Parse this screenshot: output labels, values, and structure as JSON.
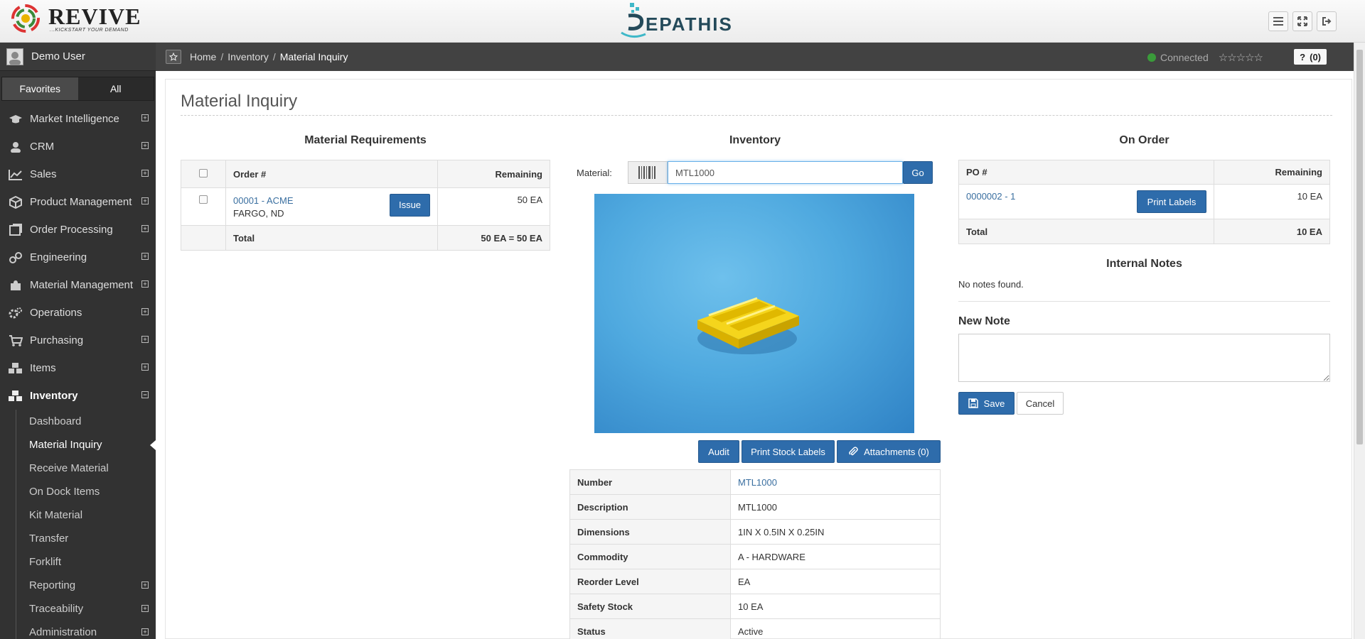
{
  "header": {
    "brand_name": "REVIVE",
    "brand_tagline": "...KICKSTART YOUR DEMAND",
    "product_name": "EPATHIS"
  },
  "user": {
    "name": "Demo User"
  },
  "sidebar": {
    "tabs": [
      {
        "label": "Favorites"
      },
      {
        "label": "All"
      }
    ],
    "items": [
      {
        "label": "Market Intelligence",
        "icon": "graduation-cap-icon"
      },
      {
        "label": "CRM",
        "icon": "user-icon"
      },
      {
        "label": "Sales",
        "icon": "line-chart-icon"
      },
      {
        "label": "Product Management",
        "icon": "cube-icon"
      },
      {
        "label": "Order Processing",
        "icon": "file-icon"
      },
      {
        "label": "Engineering",
        "icon": "link-icon"
      },
      {
        "label": "Material Management",
        "icon": "puzzle-icon"
      },
      {
        "label": "Operations",
        "icon": "gears-icon"
      },
      {
        "label": "Purchasing",
        "icon": "cart-icon"
      },
      {
        "label": "Items",
        "icon": "cubes-icon"
      },
      {
        "label": "Inventory",
        "icon": "cubes-icon"
      }
    ],
    "inventory_sub": [
      {
        "label": "Dashboard"
      },
      {
        "label": "Material Inquiry"
      },
      {
        "label": "Receive Material"
      },
      {
        "label": "On Dock Items"
      },
      {
        "label": "Kit Material"
      },
      {
        "label": "Transfer"
      },
      {
        "label": "Forklift"
      },
      {
        "label": "Reporting"
      },
      {
        "label": "Traceability"
      },
      {
        "label": "Administration"
      }
    ]
  },
  "breadcrumb": {
    "items": [
      {
        "label": "Home"
      },
      {
        "label": "Inventory"
      },
      {
        "label": "Material Inquiry"
      }
    ],
    "status": "Connected",
    "stars": "☆☆☆☆☆",
    "help_label": "(0)"
  },
  "page": {
    "title": "Material Inquiry"
  },
  "requirements": {
    "title": "Material Requirements",
    "columns": {
      "order": "Order #",
      "remaining": "Remaining"
    },
    "rows": [
      {
        "order": "00001 - ACME",
        "location": "FARGO, ND",
        "remaining": "50 EA",
        "button": "Issue"
      }
    ],
    "total_label": "Total",
    "total_value": "50 EA = 50 EA"
  },
  "inventory": {
    "title": "Inventory",
    "material_label": "Material:",
    "material_value": "MTL1000",
    "go_label": "Go",
    "buttons": {
      "audit": "Audit",
      "print_stock": "Print Stock Labels",
      "attachments": "Attachments (0)"
    },
    "details": [
      {
        "key": "Number",
        "value": "MTL1000",
        "link": true
      },
      {
        "key": "Description",
        "value": "MTL1000",
        "link": false
      },
      {
        "key": "Dimensions",
        "value": "1IN X 0.5IN X 0.25IN",
        "link": false
      },
      {
        "key": "Commodity",
        "value": "A - HARDWARE",
        "link": false
      },
      {
        "key": "Reorder Level",
        "value": "EA",
        "link": false
      },
      {
        "key": "Safety Stock",
        "value": "10 EA",
        "link": false
      },
      {
        "key": "Status",
        "value": "Active",
        "link": false
      }
    ]
  },
  "on_order": {
    "title": "On Order",
    "columns": {
      "po": "PO #",
      "remaining": "Remaining"
    },
    "rows": [
      {
        "po": "0000002 - 1",
        "remaining": "10 EA",
        "button": "Print Labels"
      }
    ],
    "total_label": "Total",
    "total_value": "10 EA"
  },
  "notes": {
    "title": "Internal Notes",
    "empty": "No notes found.",
    "new_title": "New Note",
    "save_label": "Save",
    "cancel_label": "Cancel"
  },
  "colors": {
    "primary": "#2e6cab",
    "sidebar": "#323232",
    "link": "#3a6fa0",
    "connected": "#3a9b3a"
  }
}
